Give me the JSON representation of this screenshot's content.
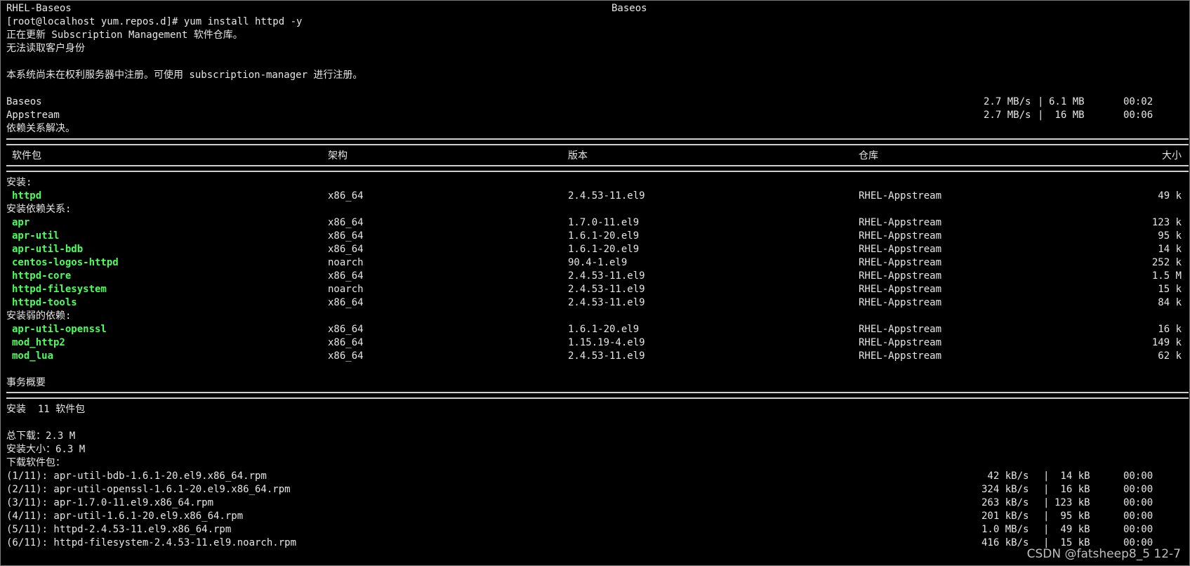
{
  "header": {
    "left": "RHEL-Baseos",
    "center": "Baseos"
  },
  "lines_top": [
    "[root@localhost yum.repos.d]# yum install httpd -y",
    "正在更新 Subscription Management 软件仓库。",
    "无法读取客户身份",
    "",
    "本系统尚未在权利服务器中注册。可使用 subscription-manager 进行注册。"
  ],
  "repos": [
    {
      "name": "Baseos",
      "rate": "2.7 MB/s",
      "size": "6.1 MB",
      "time": "00:02"
    },
    {
      "name": "Appstream",
      "rate": "2.7 MB/s",
      "size": " 16 MB",
      "time": "00:06"
    }
  ],
  "deps_resolved": "依赖关系解决。",
  "table": {
    "headers": {
      "package": "软件包",
      "arch": "架构",
      "version": "版本",
      "repo": "仓库",
      "size": "大小"
    },
    "groups": [
      {
        "title": "安装:",
        "rows": [
          {
            "name": "httpd",
            "arch": "x86_64",
            "version": "2.4.53-11.el9",
            "repo": "RHEL-Appstream",
            "size": "49 k"
          }
        ]
      },
      {
        "title": "安装依赖关系:",
        "rows": [
          {
            "name": "apr",
            "arch": "x86_64",
            "version": "1.7.0-11.el9",
            "repo": "RHEL-Appstream",
            "size": "123 k"
          },
          {
            "name": "apr-util",
            "arch": "x86_64",
            "version": "1.6.1-20.el9",
            "repo": "RHEL-Appstream",
            "size": "95 k"
          },
          {
            "name": "apr-util-bdb",
            "arch": "x86_64",
            "version": "1.6.1-20.el9",
            "repo": "RHEL-Appstream",
            "size": "14 k"
          },
          {
            "name": "centos-logos-httpd",
            "arch": "noarch",
            "version": "90.4-1.el9",
            "repo": "RHEL-Appstream",
            "size": "252 k"
          },
          {
            "name": "httpd-core",
            "arch": "x86_64",
            "version": "2.4.53-11.el9",
            "repo": "RHEL-Appstream",
            "size": "1.5 M"
          },
          {
            "name": "httpd-filesystem",
            "arch": "noarch",
            "version": "2.4.53-11.el9",
            "repo": "RHEL-Appstream",
            "size": "15 k"
          },
          {
            "name": "httpd-tools",
            "arch": "x86_64",
            "version": "2.4.53-11.el9",
            "repo": "RHEL-Appstream",
            "size": "84 k"
          }
        ]
      },
      {
        "title": "安装弱的依赖:",
        "rows": [
          {
            "name": "apr-util-openssl",
            "arch": "x86_64",
            "version": "1.6.1-20.el9",
            "repo": "RHEL-Appstream",
            "size": "16 k"
          },
          {
            "name": "mod_http2",
            "arch": "x86_64",
            "version": "1.15.19-4.el9",
            "repo": "RHEL-Appstream",
            "size": "149 k"
          },
          {
            "name": "mod_lua",
            "arch": "x86_64",
            "version": "2.4.53-11.el9",
            "repo": "RHEL-Appstream",
            "size": "62 k"
          }
        ]
      }
    ]
  },
  "summary": {
    "title": "事务概要",
    "install_line": "安装  11 软件包",
    "total_download": "总下载：2.3 M",
    "installed_size": "安装大小：6.3 M",
    "downloading": "下载软件包："
  },
  "downloads": [
    {
      "file": "(1/11): apr-util-bdb-1.6.1-20.el9.x86_64.rpm",
      "rate": " 42 kB/s",
      "size": " 14 kB",
      "time": "00:00"
    },
    {
      "file": "(2/11): apr-util-openssl-1.6.1-20.el9.x86_64.rpm",
      "rate": "324 kB/s",
      "size": " 16 kB",
      "time": "00:00"
    },
    {
      "file": "(3/11): apr-1.7.0-11.el9.x86_64.rpm",
      "rate": "263 kB/s",
      "size": "123 kB",
      "time": "00:00"
    },
    {
      "file": "(4/11): apr-util-1.6.1-20.el9.x86_64.rpm",
      "rate": "201 kB/s",
      "size": " 95 kB",
      "time": "00:00"
    },
    {
      "file": "(5/11): httpd-2.4.53-11.el9.x86_64.rpm",
      "rate": "1.0 MB/s",
      "size": " 49 kB",
      "time": "00:00"
    },
    {
      "file": "(6/11): httpd-filesystem-2.4.53-11.el9.noarch.rpm",
      "rate": "416 kB/s",
      "size": " 15 kB",
      "time": "00:00"
    }
  ],
  "watermark": "CSDN @fatsheep8_5 12-7",
  "colors": {
    "background": "#000000",
    "text": "#e6e6e6",
    "package_name": "#4bff5a"
  }
}
